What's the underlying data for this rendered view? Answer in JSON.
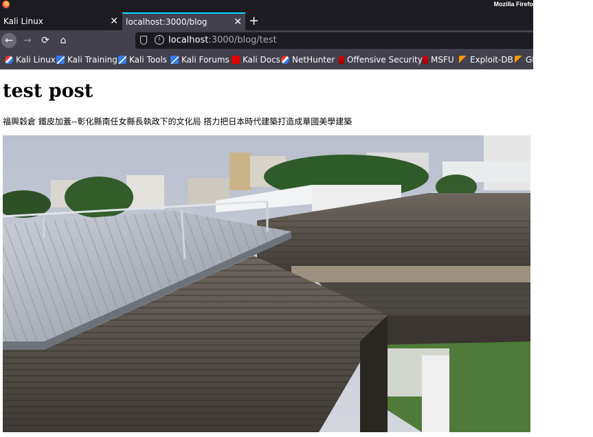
{
  "window": {
    "title": "Mozilla Firefo"
  },
  "tabs": [
    {
      "label": "Kali Linux",
      "close": "✕"
    },
    {
      "label": "localhost:3000/blog",
      "close": "✕"
    }
  ],
  "new_tab": "+",
  "nav": {
    "back": "←",
    "forward": "→",
    "reload": "⟳",
    "home": "⌂"
  },
  "url": {
    "host": "localhost",
    "rest": ":3000/blog/test"
  },
  "bookmarks": [
    {
      "label": "Kali Linux",
      "icon": "kali-icon"
    },
    {
      "label": "Kali Training",
      "icon": "training-icon"
    },
    {
      "label": "Kali Tools",
      "icon": "tools-icon"
    },
    {
      "label": "Kali Forums",
      "icon": "forums-icon"
    },
    {
      "label": "Kali Docs",
      "icon": "docs-icon"
    },
    {
      "label": "NetHunter",
      "icon": "nethunter-icon"
    },
    {
      "label": "Offensive Security",
      "icon": "offsec-icon"
    },
    {
      "label": "MSFU",
      "icon": "msfu-icon"
    },
    {
      "label": "Exploit-DB",
      "icon": "exploit-icon"
    },
    {
      "label": "GH",
      "icon": "ghdb-icon"
    }
  ],
  "post": {
    "title": "test post",
    "body": "福興穀倉 鐵皮加蓋--彰化縣南任女縣長執政下的文化局 搭力把日本時代建築打造成華國美學建築"
  },
  "colors": {
    "chrome_dark": "#1c1b22",
    "chrome": "#42414d",
    "tab_accent": "#00ddff"
  }
}
